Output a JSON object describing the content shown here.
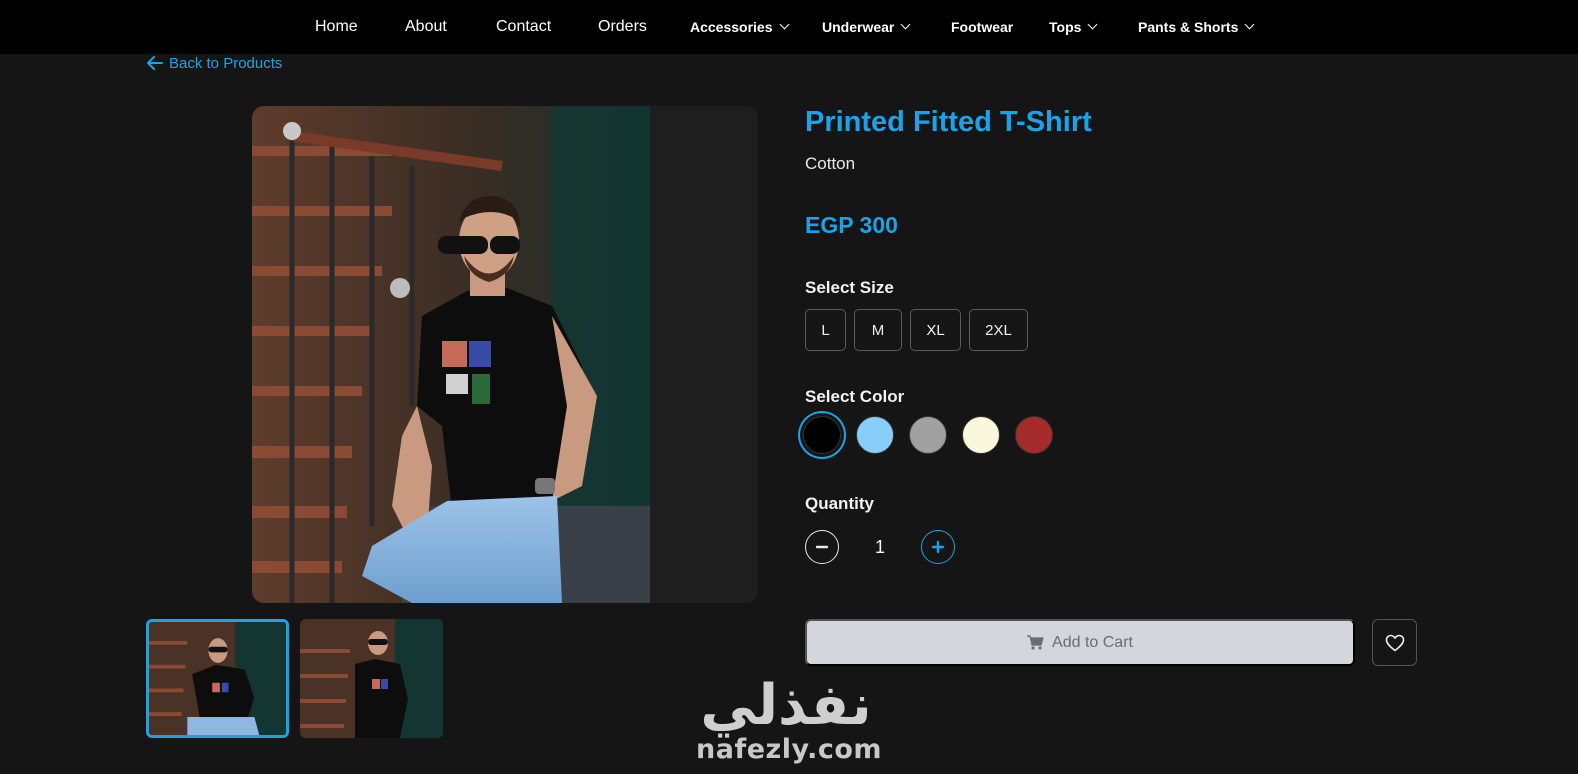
{
  "nav": {
    "items": [
      {
        "label": "Home"
      },
      {
        "label": "About"
      },
      {
        "label": "Contact"
      },
      {
        "label": "Orders"
      },
      {
        "label": "Accessories"
      },
      {
        "label": "Underwear"
      },
      {
        "label": "Footwear"
      },
      {
        "label": "Tops"
      },
      {
        "label": "Pants & Shorts"
      }
    ]
  },
  "back_link": "Back to Products",
  "product": {
    "title": "Printed Fitted T-Shirt",
    "material": "Cotton",
    "price": "EGP 300"
  },
  "size": {
    "label": "Select Size",
    "options": [
      "L",
      "M",
      "XL",
      "2XL"
    ]
  },
  "color": {
    "label": "Select Color",
    "options": [
      "#000000",
      "#87cefa",
      "#a0a0a0",
      "#fbf7dc",
      "#a52a2a"
    ],
    "selected": "#000000"
  },
  "quantity": {
    "label": "Quantity",
    "value": "1"
  },
  "cart": {
    "label": "Add to Cart"
  },
  "watermark": {
    "logo_text": "نفذلي",
    "domain": "nafezly.com"
  },
  "accent": "#1aa3e8"
}
